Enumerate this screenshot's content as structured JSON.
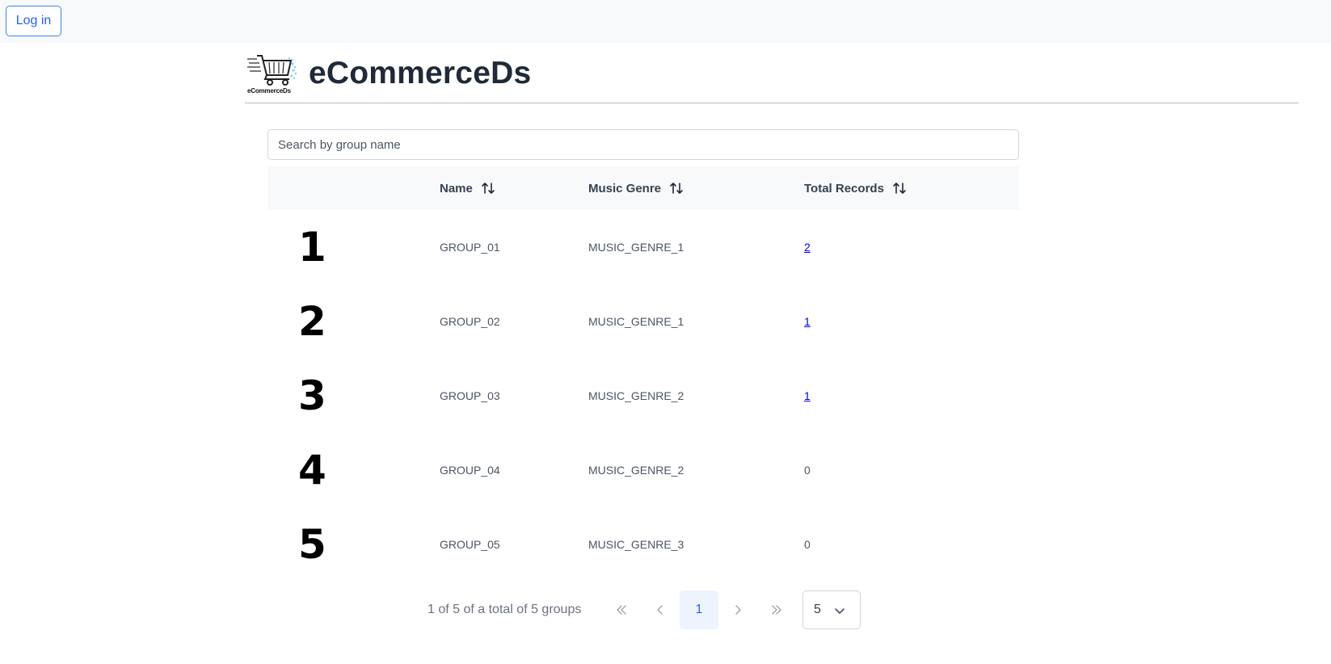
{
  "topbar": {
    "login_label": "Log in"
  },
  "brand": {
    "title": "eCommerceDs",
    "logo_text": "eCommerceDs"
  },
  "search": {
    "placeholder": "Search by group name",
    "value": ""
  },
  "table": {
    "headers": {
      "name": "Name",
      "genre": "Music Genre",
      "total": "Total Records"
    },
    "rows": [
      {
        "index": "1",
        "name": "GROUP_01",
        "genre": "MUSIC_GENRE_1",
        "total": "2",
        "total_is_link": true
      },
      {
        "index": "2",
        "name": "GROUP_02",
        "genre": "MUSIC_GENRE_1",
        "total": "1",
        "total_is_link": true
      },
      {
        "index": "3",
        "name": "GROUP_03",
        "genre": "MUSIC_GENRE_2",
        "total": "1",
        "total_is_link": true
      },
      {
        "index": "4",
        "name": "GROUP_04",
        "genre": "MUSIC_GENRE_2",
        "total": "0",
        "total_is_link": false
      },
      {
        "index": "5",
        "name": "GROUP_05",
        "genre": "MUSIC_GENRE_3",
        "total": "0",
        "total_is_link": false
      }
    ]
  },
  "pagination": {
    "info": "1 of 5 of a total of 5 groups",
    "first_icon": "double-chevron-left-icon",
    "prev_icon": "chevron-left-icon",
    "current_page": "1",
    "next_icon": "chevron-right-icon",
    "last_icon": "double-chevron-right-icon",
    "page_size": "5"
  },
  "colors": {
    "accent": "#2563eb",
    "header_bg": "#f8f9fa",
    "link": "#0000ee"
  }
}
